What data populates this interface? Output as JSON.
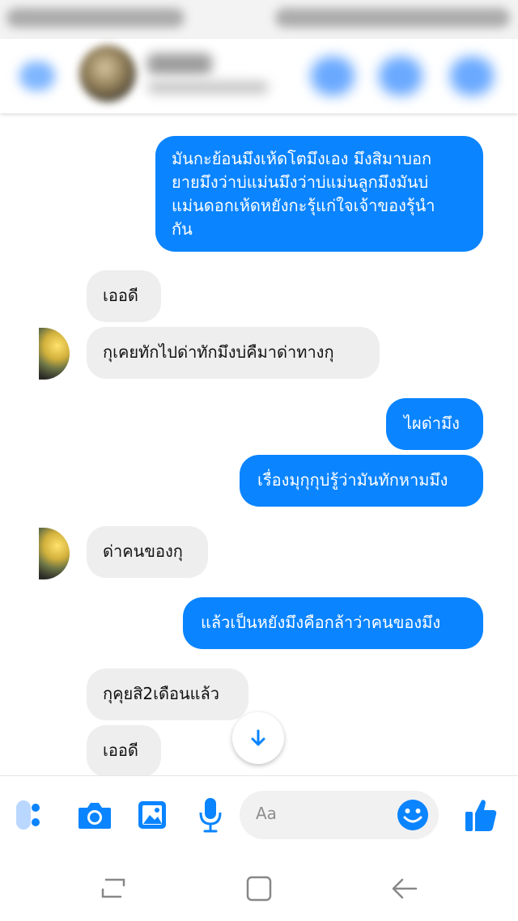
{
  "conversation": {
    "messages": [
      {
        "direction": "out",
        "text": "มันกะย้อนมึงเห้ดโตมึงเอง มึงสิมาบอก\nยายมึงว่าบ่แม่นมึงว่าบ่แม่นลูกมึงมันบ่\nแม่นดอกเห้ดหยังกะรุ้แก่ใจเจ้าของรุ้นำ\nกัน"
      },
      {
        "direction": "in",
        "text": "เออดี"
      },
      {
        "direction": "in",
        "text": "กุเคยทักไปด่าทักมึงบ่คืมาด่าทางกุ"
      },
      {
        "direction": "out",
        "text": "ไผด่ามึง"
      },
      {
        "direction": "out",
        "text": "เรื่องมุกุกุบ่รู้ว่ามันทักหามมึง"
      },
      {
        "direction": "in",
        "text": "ด่าคนของกุ"
      },
      {
        "direction": "out",
        "text": "แล้วเป็นหยังมึงคือกล้าว่าคนของมึง"
      },
      {
        "direction": "in",
        "text": "กุคุยสิ2เดือนแล้ว"
      },
      {
        "direction": "in",
        "text": "เออดี"
      }
    ]
  },
  "composer": {
    "placeholder": "Aa"
  },
  "icons": {
    "back": "back-arrow-icon",
    "call": "phone-icon",
    "video": "video-camera-icon",
    "info": "info-icon",
    "more": "more-dots-icon",
    "camera": "camera-icon",
    "gallery": "image-icon",
    "mic": "microphone-icon",
    "emoji": "emoji-icon",
    "like": "thumbs-up-icon",
    "scroll": "arrow-down-icon",
    "nav_recent": "recent-apps-icon",
    "nav_home": "home-icon",
    "nav_back": "nav-back-icon"
  },
  "colors": {
    "accent": "#0a84ff",
    "incoming_bubble": "#eeeeee",
    "outgoing_text": "#ffffff"
  }
}
